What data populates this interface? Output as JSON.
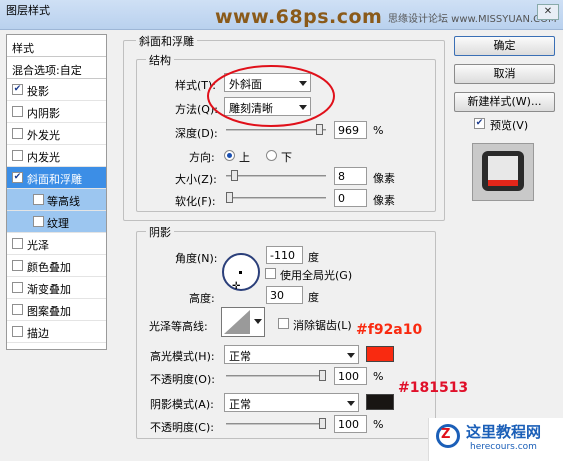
{
  "window": {
    "title": "图层样式",
    "close_label": "✕"
  },
  "watermark": {
    "text": "www.68ps.com"
  },
  "forum_watermark": {
    "text": "思缘设计论坛 www.MISSYUAN.COM"
  },
  "sidebar": {
    "header": "样式",
    "blend_options": "混合选项:自定",
    "items": [
      {
        "label": "投影",
        "checked": true
      },
      {
        "label": "内阴影",
        "checked": false
      },
      {
        "label": "外发光",
        "checked": false
      },
      {
        "label": "内发光",
        "checked": false
      },
      {
        "label": "斜面和浮雕",
        "checked": true,
        "selected": true
      },
      {
        "label": "等高线",
        "checked": false,
        "sub": true
      },
      {
        "label": "纹理",
        "checked": false,
        "sub": true
      },
      {
        "label": "光泽",
        "checked": false
      },
      {
        "label": "颜色叠加",
        "checked": false
      },
      {
        "label": "渐变叠加",
        "checked": false
      },
      {
        "label": "图案叠加",
        "checked": false
      },
      {
        "label": "描边",
        "checked": false
      }
    ]
  },
  "bevel": {
    "section_title": "斜面和浮雕",
    "structure_title": "结构",
    "style_label": "样式(T):",
    "style_value": "外斜面",
    "technique_label": "方法(Q):",
    "technique_value": "雕刻清晰",
    "depth_label": "深度(D):",
    "depth_value": "969",
    "depth_unit": "%",
    "depth_fraction": 0.97,
    "direction_label": "方向:",
    "direction_up": "上",
    "direction_down": "下",
    "direction_selected": "up",
    "size_label": "大小(Z):",
    "size_value": "8",
    "size_unit": "像素",
    "size_fraction": 0.05,
    "soften_label": "软化(F):",
    "soften_value": "0",
    "soften_unit": "像素",
    "soften_fraction": 0.0
  },
  "shading": {
    "section_title": "阴影",
    "angle_label": "角度(N):",
    "angle_value": "-110",
    "angle_unit": "度",
    "global_light_label": "使用全局光(G)",
    "global_light_checked": false,
    "altitude_label": "高度:",
    "altitude_value": "30",
    "altitude_unit": "度",
    "gloss_contour_label": "光泽等高线:",
    "antialiased_label": "消除锯齿(L)",
    "antialiased_checked": false,
    "highlight_mode_label": "高光模式(H):",
    "highlight_mode_value": "正常",
    "highlight_color": "#f92a10",
    "highlight_opacity_label": "不透明度(O):",
    "highlight_opacity_value": "100",
    "highlight_opacity_unit": "%",
    "highlight_opacity_fraction": 1.0,
    "shadow_mode_label": "阴影模式(A):",
    "shadow_mode_value": "正常",
    "shadow_color": "#181513",
    "shadow_opacity_label": "不透明度(C):",
    "shadow_opacity_value": "100",
    "shadow_opacity_unit": "%",
    "shadow_opacity_fraction": 1.0
  },
  "annotations": {
    "highlight_hex": "#f92a10",
    "shadow_hex": "#181513"
  },
  "buttons": {
    "ok": "确定",
    "cancel": "取消",
    "new_style": "新建样式(W)...",
    "preview_label": "预览(V)",
    "preview_checked": true
  },
  "logo": {
    "name": "这里教程网",
    "url": "herecours.com"
  }
}
